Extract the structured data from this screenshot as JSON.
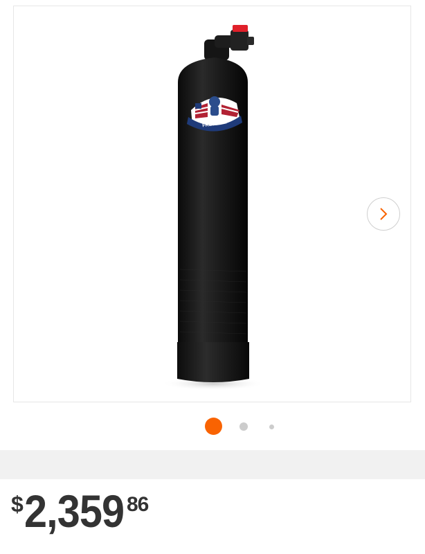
{
  "gallery": {
    "product_name": "Freedom water filter tank",
    "logo_text": "FREEDOM",
    "next_icon": "chevron-right-icon",
    "current_index": 1,
    "total_images": 3,
    "colors": {
      "accent": "#f96302",
      "inactive_dot": "#cccccc",
      "tank": "#161616"
    }
  },
  "price": {
    "currency": "$",
    "dollars": "2,359",
    "cents": "86"
  }
}
